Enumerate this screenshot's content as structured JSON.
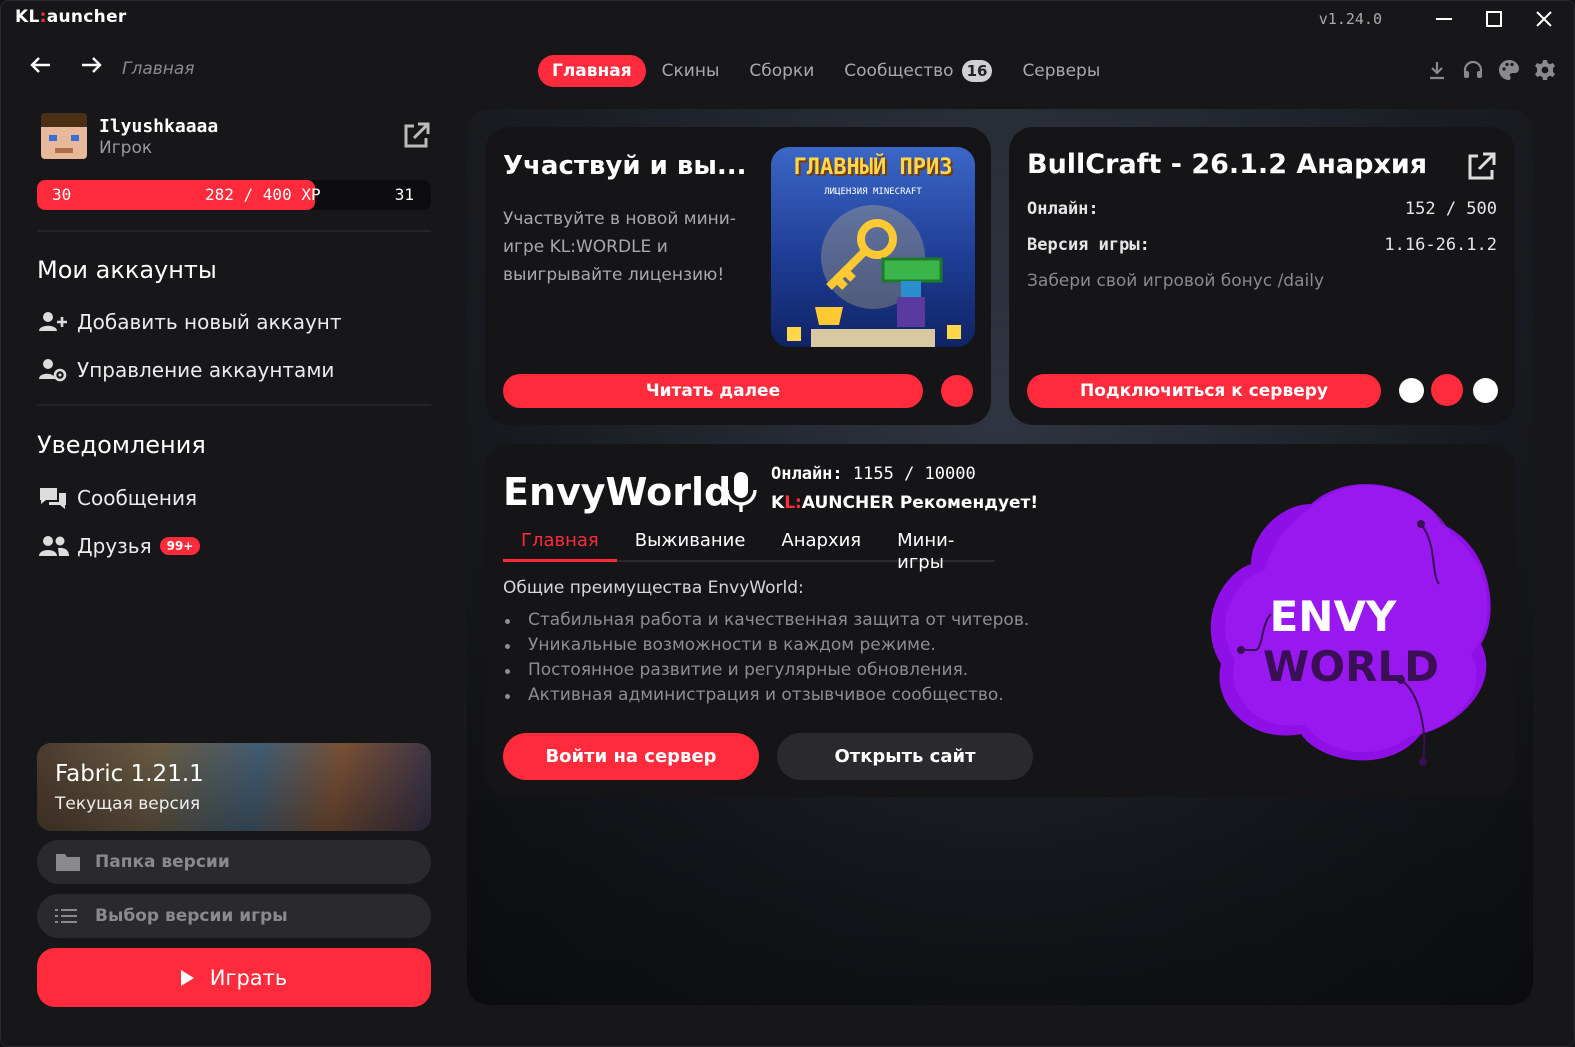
{
  "window": {
    "title_kl": "KL",
    "title_colon": ":",
    "title_rest": "auncher",
    "version": "v1.24.0"
  },
  "nav": {
    "breadcrumb": "Главная",
    "tabs": [
      {
        "label": "Главная",
        "active": true
      },
      {
        "label": "Скины"
      },
      {
        "label": "Сборки"
      },
      {
        "label": "Сообщество",
        "badge": "16"
      },
      {
        "label": "Серверы"
      }
    ],
    "tool_icons": [
      "download-icon",
      "headset-icon",
      "palette-icon",
      "gear-icon"
    ]
  },
  "profile": {
    "username": "Ilyushkaaaa",
    "role": "Игрок",
    "level_current": "30",
    "xp_text": "282 / 400 XP",
    "level_next": "31",
    "xp_fraction": 0.705
  },
  "accounts": {
    "title": "Мои аккаунты",
    "add": "Добавить новый аккаунт",
    "manage": "Управление аккаунтами"
  },
  "notifications": {
    "title": "Уведомления",
    "messages": "Сообщения",
    "friends": "Друзья",
    "friends_badge": "99+"
  },
  "version_card": {
    "name": "Fabric 1.21.1",
    "subtitle": "Текущая версия",
    "folder_button": "Папка версии",
    "select_button": "Выбор версии игры",
    "play_button": "Играть"
  },
  "news_card": {
    "title": "Участвуй и вы...",
    "text": "Участвуйте в новой мини-игре KL:WORDLE и выигрывайте лицензию!",
    "image_title": "ГЛАВНЫЙ ПРИЗ",
    "image_subtitle": "ЛИЦЕНЗИЯ MINECRAFT",
    "button": "Читать далее"
  },
  "server_card": {
    "title": "BullCraft - 26.1.2 Анархия",
    "online_label": "Онлайн:",
    "online_value": "152 / 500",
    "version_label": "Версия игры:",
    "version_value": "1.16-26.1.2",
    "note": "Забери свой игровой бонус /daily",
    "button": "Подключиться к серверу"
  },
  "featured": {
    "title": "EnvyWorld",
    "online_label": "Онлайн:",
    "online_value": "1155 / 10000",
    "rec_k": "K",
    "rec_l": "L",
    "rec_colon": ":",
    "rec_rest": "AUNCHER Рекомендует!",
    "tabs": [
      "Главная",
      "Выживание",
      "Анархия",
      "Мини-игры"
    ],
    "heading": "Общие преимущества EnvyWorld:",
    "bullets": [
      "Стабильная работа и качественная защита от читеров.",
      "Уникальные возможности в каждом режиме.",
      "Постоянное развитие и регулярные обновления.",
      "Активная администрация и отзывчивое сообщество."
    ],
    "join_button": "Войти на сервер",
    "site_button": "Открыть сайт",
    "logo_line1": "ENVY",
    "logo_line2": "WORLD"
  },
  "colors": {
    "accent": "#ff2a3c",
    "background": "#17171a",
    "card": "#151517",
    "logo_purple": "#8f10e6"
  }
}
